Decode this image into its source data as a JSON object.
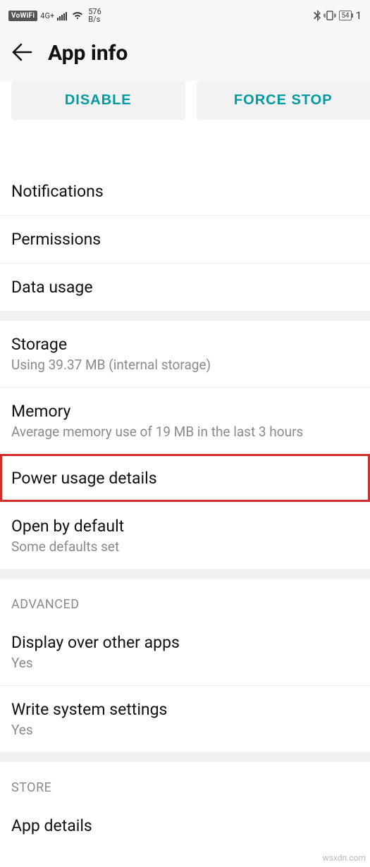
{
  "status": {
    "vowifi": "VoWiFi",
    "net_gen": "4G+",
    "speed_num": "576",
    "speed_unit": "B/s",
    "battery": "54",
    "trail": "1"
  },
  "header": {
    "title": "App info"
  },
  "actions": {
    "disable": "DISABLE",
    "force_stop": "FORCE STOP"
  },
  "groups": {
    "g1": {
      "notifications": "Notifications",
      "permissions": "Permissions",
      "data_usage": "Data usage"
    },
    "g2": {
      "storage_title": "Storage",
      "storage_sub": "Using 39.37 MB (internal storage)",
      "memory_title": "Memory",
      "memory_sub": "Average memory use of 19 MB in the last 3 hours",
      "power_title": "Power usage details",
      "open_title": "Open by default",
      "open_sub": "Some defaults set"
    },
    "advanced_header": "ADVANCED",
    "g3": {
      "overlay_title": "Display over other apps",
      "overlay_sub": "Yes",
      "write_title": "Write system settings",
      "write_sub": "Yes"
    },
    "store_header": "STORE",
    "g4": {
      "app_details": "App details"
    }
  },
  "watermark": "wsxdn.com"
}
